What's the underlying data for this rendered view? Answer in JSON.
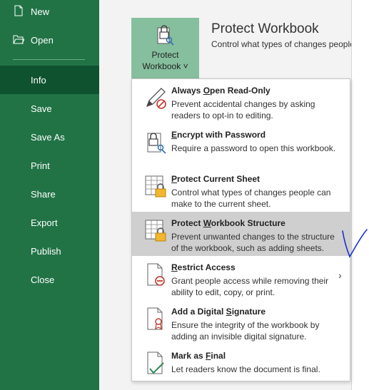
{
  "sidebar": {
    "items": [
      {
        "label": "New",
        "icon": "new-document-icon"
      },
      {
        "label": "Open",
        "icon": "open-folder-icon"
      },
      {
        "label": "Info"
      },
      {
        "label": "Save"
      },
      {
        "label": "Save As"
      },
      {
        "label": "Print"
      },
      {
        "label": "Share"
      },
      {
        "label": "Export"
      },
      {
        "label": "Publish"
      },
      {
        "label": "Close"
      }
    ],
    "active": "Info",
    "colors": {
      "background": "#217346",
      "active": "#0f5230"
    }
  },
  "protect": {
    "button_line1": "Protect",
    "button_line2": "Workbook",
    "chevron": "˅",
    "title": "Protect Workbook",
    "description": "Control what types of changes people can make to this workbook."
  },
  "menu": {
    "items": [
      {
        "title_pre": "Always ",
        "title_u": "O",
        "title_post": "pen Read-Only",
        "desc": "Prevent accidental changes by asking readers to opt-in to editing.",
        "icon": "pencil-no-icon"
      },
      {
        "title_pre": "",
        "title_u": "E",
        "title_post": "ncrypt with Password",
        "desc": "Require a password to open this workbook.",
        "icon": "lock-key-icon"
      },
      {
        "title_pre": "",
        "title_u": "P",
        "title_post": "rotect Current Sheet",
        "desc": "Control what types of changes people can make to the current sheet.",
        "icon": "sheet-lock-icon"
      },
      {
        "title_pre": "Protect ",
        "title_u": "W",
        "title_post": "orkbook Structure",
        "desc": "Prevent unwanted changes to the structure of the workbook, such as adding sheets.",
        "icon": "workbook-lock-icon"
      },
      {
        "title_pre": "",
        "title_u": "R",
        "title_post": "estrict Access",
        "desc": "Grant people access while removing their ability to edit, copy, or print.",
        "icon": "document-restrict-icon",
        "arrow": "›"
      },
      {
        "title_pre": "Add a Digital ",
        "title_u": "S",
        "title_post": "ignature",
        "desc": "Ensure the integrity of the workbook by adding an invisible digital signature.",
        "icon": "document-ribbon-icon"
      },
      {
        "title_pre": "Mark as ",
        "title_u": "F",
        "title_post": "inal",
        "desc": "Let readers know the document is final.",
        "icon": "document-check-icon"
      }
    ],
    "highlighted": "Protect Workbook Structure"
  }
}
